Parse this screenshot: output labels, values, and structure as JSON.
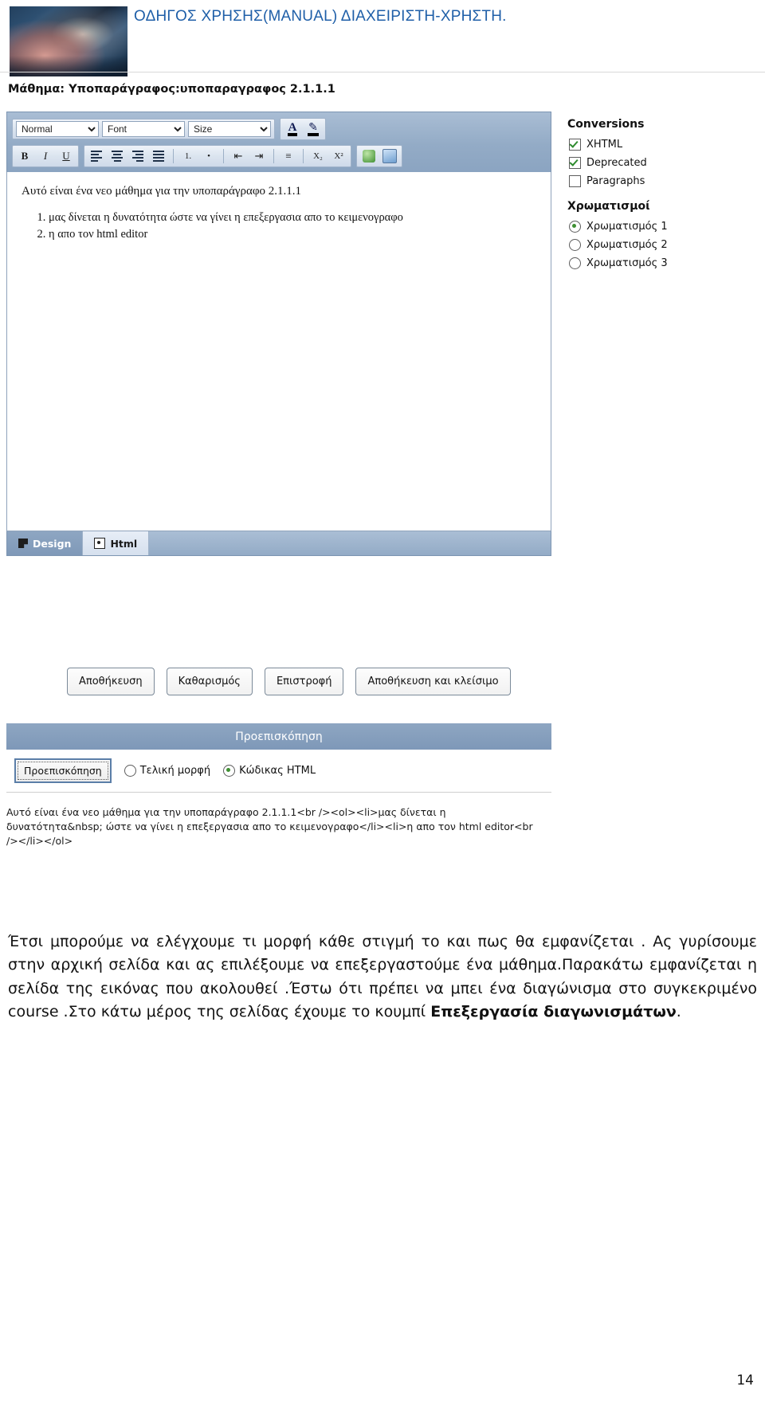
{
  "header": {
    "title": "ΟΔΗΓΟΣ ΧΡΗΣΗΣ(MANUAL) ΔΙΑΧΕΙΡΙΣΤΗ-ΧΡΗΣΤΗ.",
    "photo_alt": "keyboard-hands-photo",
    "title_color": "#1f5fa8"
  },
  "course_line": "Μάθημα: Υποπαράγραφος:υποπαραγραφος 2.1.1.1",
  "editor": {
    "toolbar": {
      "style_select": {
        "value": "Normal",
        "options": [
          "Normal"
        ]
      },
      "font_select": {
        "value": "Font",
        "options": [
          "Font"
        ]
      },
      "size_select": {
        "value": "Size",
        "options": [
          "Size"
        ]
      },
      "forecolor_label": "A",
      "backcolor_label": "✎",
      "bold": "B",
      "italic": "I",
      "underline": "U",
      "align_left": "align-left",
      "align_center": "align-center",
      "align_right": "align-right",
      "align_justify": "align-justify",
      "ordered_list": "1.",
      "unordered_list": "•",
      "indent": "indent",
      "outdent": "outdent",
      "line_rule": "hr",
      "subscript": "X₂",
      "superscript": "X²",
      "insert_link": "link",
      "insert_image": "image"
    },
    "content": {
      "paragraph": "Αυτό είναι ένα νεο μάθημα για την υποπαράγραφο 2.1.1.1",
      "list_items": [
        "μας δίνεται η δυνατότητα  ώστε να γίνει η επεξεργασια απο το κειμενογραφο",
        "η απο τον html editor"
      ]
    },
    "tabs": [
      {
        "label": "Design",
        "icon": "design-icon",
        "active": true
      },
      {
        "label": "Html",
        "icon": "html-icon",
        "active": false
      }
    ]
  },
  "side_panel": {
    "conversions_title": "Conversions",
    "conversions": [
      {
        "label": "XHTML",
        "checked": true
      },
      {
        "label": "Deprecated",
        "checked": true
      },
      {
        "label": "Paragraphs",
        "checked": false
      }
    ],
    "colors_title": "Χρωματισμοί",
    "colors": [
      {
        "label": "Χρωματισμός 1",
        "selected": true
      },
      {
        "label": "Χρωματισμός 2",
        "selected": false
      },
      {
        "label": "Χρωματισμός 3",
        "selected": false
      }
    ]
  },
  "actions": [
    "Αποθήκευση",
    "Καθαρισμός",
    "Επιστροφή",
    "Αποθήκευση και κλείσιμο"
  ],
  "preview": {
    "header": "Προεπισκόπηση",
    "button": "Προεπισκόπηση",
    "radios": [
      {
        "label": "Τελική μορφή",
        "selected": false
      },
      {
        "label": "Κώδικας HTML",
        "selected": true
      }
    ],
    "code": "Αυτό είναι ένα νεο μάθημα για την υποπαράγραφο 2.1.1.1<br /><ol><li>μας δίνεται η δυνατότητα&nbsp; ώστε να γίνει η επεξεργασια απο το κειμενογραφο</li><li>η απο τον html editor<br /></li></ol>"
  },
  "body_text": {
    "part1": "Έτσι μπορούμε να ελέγχουμε τι μορφή κάθε στιγμή το και    πως θα εμφανίζεται .  Ας γυρίσουμε στην αρχική σελίδα  και ας επιλέξουμε  να επεξεργαστούμε ένα μάθημα.Παρακάτω εμφανίζεται η σελίδα της εικόνας που ακολουθεί .Έστω ότι πρέπει να μπει ένα διαγώνισμα στο συγκεκριμένο course .Στο κάτω μέρος της σελίδας   έχουμε το κουμπί ",
    "bold": "Επεξεργασία διαγωνισμάτων",
    "part2": "."
  },
  "page_number": "14"
}
